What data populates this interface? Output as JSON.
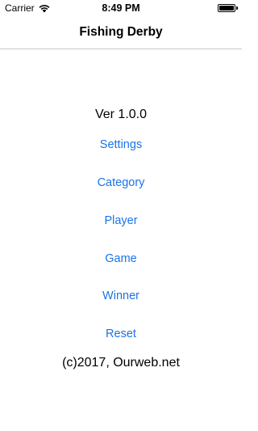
{
  "status_bar": {
    "carrier": "Carrier",
    "time": "8:49 PM",
    "wifi_icon": "wifi-icon",
    "battery_icon": "battery-icon",
    "battery_level": 1.0
  },
  "nav": {
    "title": "Fishing Derby"
  },
  "main": {
    "version": "Ver 1.0.0",
    "menu": [
      {
        "label": "Settings"
      },
      {
        "label": "Category"
      },
      {
        "label": "Player"
      },
      {
        "label": "Game"
      },
      {
        "label": "Winner"
      },
      {
        "label": "Reset"
      }
    ],
    "copyright": "(c)2017, Ourweb.net"
  },
  "colors": {
    "link": "#1a73e8",
    "text": "#000000",
    "divider": "#c8c8c8",
    "background": "#ffffff"
  }
}
